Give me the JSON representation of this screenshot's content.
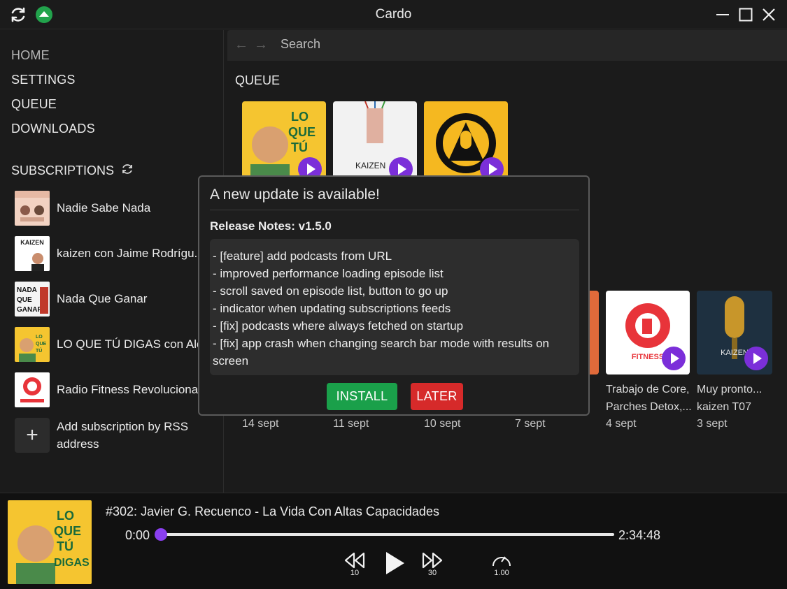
{
  "window": {
    "title": "Cardo"
  },
  "nav": {
    "home": "HOME",
    "settings": "SETTINGS",
    "queue": "QUEUE",
    "downloads": "DOWNLOADS"
  },
  "subscriptions": {
    "heading": "SUBSCRIPTIONS",
    "items": [
      {
        "name": "Nadie Sabe Nada",
        "thumb_color": "#f2d2c2"
      },
      {
        "name": "kaizen con Jaime Rodrígu...",
        "thumb_color": "#ffffff"
      },
      {
        "name": "Nada Que Ganar",
        "thumb_color": "#f4f4f4"
      },
      {
        "name": "LO QUE TÚ DIGAS con Ale...",
        "thumb_color": "#f5c530"
      },
      {
        "name": "Radio Fitness Revolucionari",
        "thumb_color": "#ffffff"
      }
    ],
    "add_label": "Add subscription by RSS address"
  },
  "search": {
    "placeholder": "Search"
  },
  "main": {
    "queue_title": "QUEUE",
    "episodes": [
      {
        "title": "",
        "date": "14 sept"
      },
      {
        "title": "",
        "date": "11 sept"
      },
      {
        "title": "",
        "date": "10 sept"
      },
      {
        "title": ".",
        "date": "7 sept"
      },
      {
        "title": "Trabajo de Core, Parches Detox,...",
        "date": "4 sept"
      },
      {
        "title": "Muy pronto... kaizen T07",
        "date": "3 sept"
      }
    ]
  },
  "dialog": {
    "title": "A new update is available!",
    "release_notes_label": "Release Notes: v1.5.0",
    "notes": [
      "- [feature] add podcasts from URL",
      "- improved performance loading episode list",
      "- scroll saved on episode list, button to go up",
      "- indicator when updating subscriptions feeds",
      "- [fix] podcasts where always fetched on startup",
      "- [fix] app crash when changing search bar mode with results on screen"
    ],
    "install_label": "INSTALL",
    "later_label": "LATER"
  },
  "player": {
    "now_playing": "#302: Javier G. Recuenco - La Vida Con Altas Capacidades",
    "current_time": "0:00",
    "total_time": "2:34:48",
    "progress": 0,
    "rewind_seconds": "10",
    "forward_seconds": "30",
    "speed": "1.00"
  },
  "colors": {
    "accent": "#7b2fd9",
    "install": "#1aa04a",
    "later": "#d62a2a",
    "update_badge": "#22a34c"
  }
}
